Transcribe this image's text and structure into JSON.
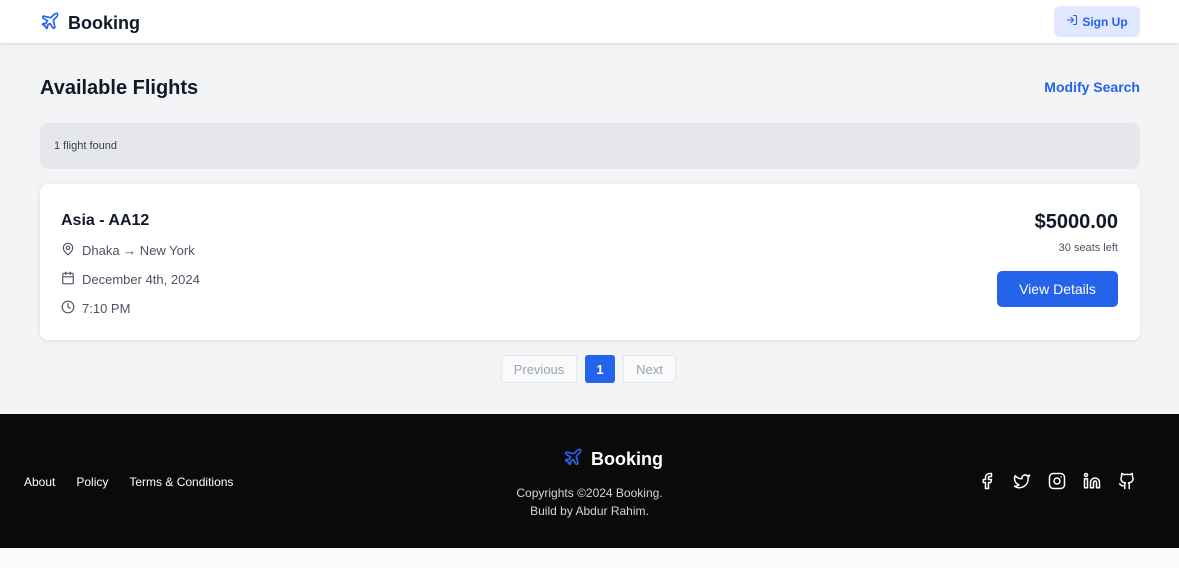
{
  "header": {
    "brand": "Booking",
    "signup_label": "Sign Up"
  },
  "main": {
    "title": "Available Flights",
    "modify_label": "Modify Search",
    "results_count": "1 flight found"
  },
  "flight": {
    "name": "Asia - AA12",
    "route": "Dhaka → New York",
    "date": "December 4th, 2024",
    "time": "7:10 PM",
    "price": "$5000.00",
    "seats": "30 seats left",
    "details_label": "View Details"
  },
  "pagination": {
    "previous": "Previous",
    "current": "1",
    "next": "Next"
  },
  "footer": {
    "links": [
      "About",
      "Policy",
      "Terms & Conditions"
    ],
    "brand": "Booking",
    "copyright": "Copyrights ©2024 Booking.",
    "credit": "Build by Abdur Rahim."
  },
  "icons": {
    "brand": "plane-icon",
    "signup": "sign-in-icon",
    "route": "map-pin-icon",
    "date": "calendar-icon",
    "time": "clock-icon",
    "social": [
      "facebook-icon",
      "twitter-icon",
      "instagram-icon",
      "linkedin-icon",
      "github-icon"
    ]
  },
  "colors": {
    "accent": "#2563eb",
    "page_bg": "#f3f4f6",
    "footer_bg": "#0a0a0a"
  }
}
